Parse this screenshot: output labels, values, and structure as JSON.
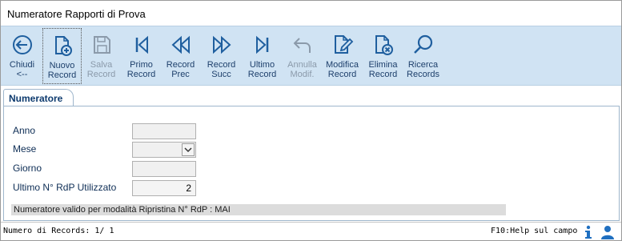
{
  "window": {
    "title": "Numeratore Rapporti di Prova"
  },
  "toolbar": {
    "buttons": [
      {
        "id": "chiudi",
        "label1": "Chiudi",
        "label2": "<--",
        "icon": "back-arrow-circle-icon",
        "enabled": true
      },
      {
        "id": "nuovo",
        "label1": "Nuovo",
        "label2": "Record",
        "icon": "new-document-icon",
        "enabled": true
      },
      {
        "id": "salva",
        "label1": "Salva",
        "label2": "Record",
        "icon": "save-icon",
        "enabled": false
      },
      {
        "id": "primo",
        "label1": "Primo",
        "label2": "Record",
        "icon": "first-record-icon",
        "enabled": true
      },
      {
        "id": "prec",
        "label1": "Record",
        "label2": "Prec",
        "icon": "previous-record-icon",
        "enabled": true
      },
      {
        "id": "succ",
        "label1": "Record",
        "label2": "Succ",
        "icon": "next-record-icon",
        "enabled": true
      },
      {
        "id": "ultimo",
        "label1": "Ultimo",
        "label2": "Record",
        "icon": "last-record-icon",
        "enabled": true
      },
      {
        "id": "annulla",
        "label1": "Annulla",
        "label2": "Modif.",
        "icon": "undo-icon",
        "enabled": false
      },
      {
        "id": "modifica",
        "label1": "Modifica",
        "label2": "Record",
        "icon": "edit-document-icon",
        "enabled": true
      },
      {
        "id": "elimina",
        "label1": "Elimina",
        "label2": "Record",
        "icon": "delete-document-icon",
        "enabled": true
      },
      {
        "id": "ricerca",
        "label1": "Ricerca",
        "label2": "Records",
        "icon": "search-icon",
        "enabled": true
      }
    ]
  },
  "tabs": [
    {
      "label": "Numeratore",
      "active": true
    }
  ],
  "form": {
    "anno": {
      "label": "Anno",
      "value": ""
    },
    "mese": {
      "label": "Mese",
      "value": ""
    },
    "giorno": {
      "label": "Giorno",
      "value": ""
    },
    "ultimo": {
      "label": "Ultimo N° RdP Utilizzato",
      "value": "2"
    }
  },
  "info": {
    "text": "Numeratore valido per modalità Ripristina N° RdP : MAI"
  },
  "status": {
    "records": "Numero di Records: 1/ 1",
    "help": "F10:Help sul campo"
  },
  "colors": {
    "toolbar_bg": "#d0e3f3",
    "icon_blue": "#1f5f9f",
    "label_blue": "#1d3f6b",
    "disabled": "#8b9aaa"
  }
}
